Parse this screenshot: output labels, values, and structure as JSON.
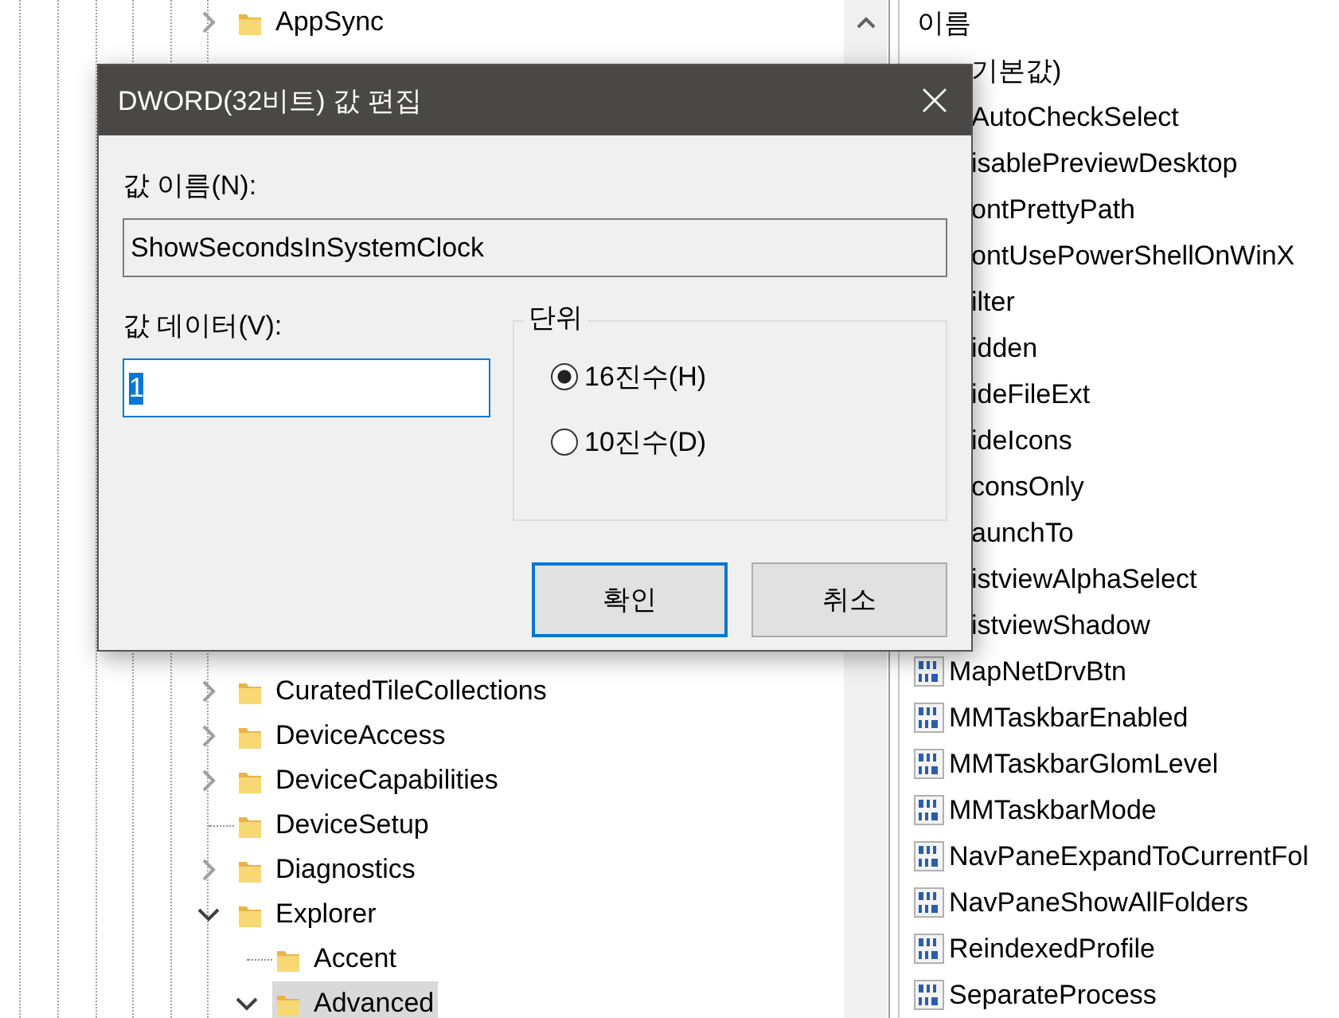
{
  "tree": {
    "items": [
      {
        "label": "AppSync",
        "kind": "collapsed",
        "selected": false
      },
      {
        "label": "CuratedTileCollections",
        "kind": "collapsed",
        "selected": false
      },
      {
        "label": "DeviceAccess",
        "kind": "collapsed",
        "selected": false
      },
      {
        "label": "DeviceCapabilities",
        "kind": "collapsed",
        "selected": false
      },
      {
        "label": "DeviceSetup",
        "kind": "leaf",
        "selected": false
      },
      {
        "label": "Diagnostics",
        "kind": "collapsed",
        "selected": false
      },
      {
        "label": "Explorer",
        "kind": "expanded",
        "selected": false,
        "children": [
          {
            "label": "Accent",
            "kind": "leaf",
            "selected": false
          },
          {
            "label": "Advanced",
            "kind": "expanded",
            "selected": true
          }
        ]
      }
    ]
  },
  "values_list": {
    "column": "이름",
    "rows": [
      {
        "name": "기본값)",
        "kind": "covered"
      },
      {
        "name": "AutoCheckSelect",
        "kind": "covered"
      },
      {
        "name": "isablePreviewDesktop",
        "kind": "covered"
      },
      {
        "name": "ontPrettyPath",
        "kind": "covered"
      },
      {
        "name": "ontUsePowerShellOnWinX",
        "kind": "covered"
      },
      {
        "name": "ilter",
        "kind": "covered"
      },
      {
        "name": "idden",
        "kind": "covered"
      },
      {
        "name": "ideFileExt",
        "kind": "covered"
      },
      {
        "name": "ideIcons",
        "kind": "covered"
      },
      {
        "name": "consOnly",
        "kind": "covered"
      },
      {
        "name": "aunchTo",
        "kind": "covered"
      },
      {
        "name": "istviewAlphaSelect",
        "kind": "covered"
      },
      {
        "name": "istviewShadow",
        "kind": "covered"
      },
      {
        "name": "MapNetDrvBtn",
        "kind": "dword"
      },
      {
        "name": "MMTaskbarEnabled",
        "kind": "dword"
      },
      {
        "name": "MMTaskbarGlomLevel",
        "kind": "dword"
      },
      {
        "name": "MMTaskbarMode",
        "kind": "dword"
      },
      {
        "name": "NavPaneExpandToCurrentFol",
        "kind": "dword"
      },
      {
        "name": "NavPaneShowAllFolders",
        "kind": "dword"
      },
      {
        "name": "ReindexedProfile",
        "kind": "dword"
      },
      {
        "name": "SeparateProcess",
        "kind": "dword"
      }
    ]
  },
  "dialog": {
    "title": "DWORD(32비트) 값 편집",
    "name_label": "값 이름(N):",
    "name_value": "ShowSecondsInSystemClock",
    "data_label": "값 데이터(V):",
    "data_value": "1",
    "data_value_selected": true,
    "unit_group": "단위",
    "radios": [
      {
        "label": "16진수(H)",
        "selected": true
      },
      {
        "label": "10진수(D)",
        "selected": false
      }
    ],
    "buttons": [
      {
        "label": "확인",
        "default": true
      },
      {
        "label": "취소",
        "default": false
      }
    ]
  }
}
